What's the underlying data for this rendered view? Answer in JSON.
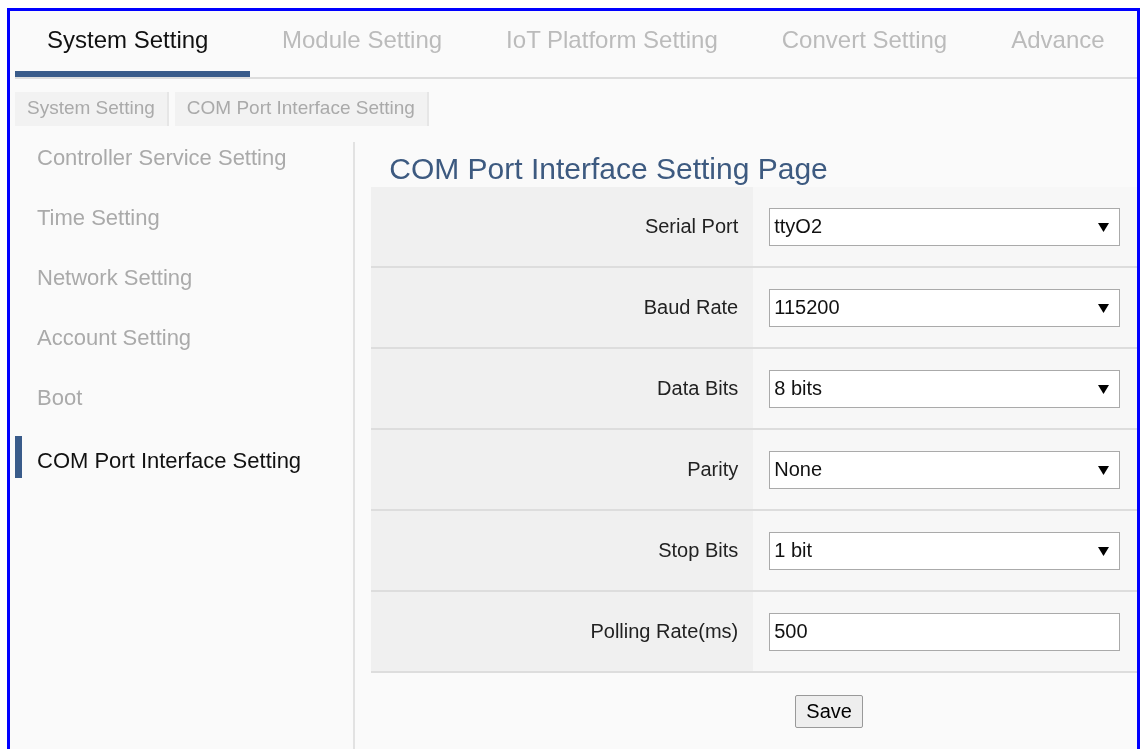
{
  "tabs": [
    {
      "label": "System Setting",
      "selected": true
    },
    {
      "label": "Module Setting",
      "selected": false
    },
    {
      "label": "IoT Platform Setting",
      "selected": false
    },
    {
      "label": "Convert Setting",
      "selected": false
    },
    {
      "label": "Advance",
      "selected": false
    }
  ],
  "breadcrumb": [
    "System Setting",
    "COM Port Interface Setting"
  ],
  "sidebar": {
    "items": [
      {
        "label": "Controller Service Setting",
        "selected": false
      },
      {
        "label": "Time Setting",
        "selected": false
      },
      {
        "label": "Network Setting",
        "selected": false
      },
      {
        "label": "Account Setting",
        "selected": false
      },
      {
        "label": "Boot",
        "selected": false
      },
      {
        "label": "COM Port Interface Setting",
        "selected": true
      }
    ]
  },
  "page_title": "COM Port Interface Setting Page",
  "fields": [
    {
      "kind": "select",
      "label": "Serial Port",
      "value": "ttyO2"
    },
    {
      "kind": "select",
      "label": "Baud Rate",
      "value": "115200"
    },
    {
      "kind": "select",
      "label": "Data Bits",
      "value": "8 bits"
    },
    {
      "kind": "select",
      "label": "Parity",
      "value": "None"
    },
    {
      "kind": "select",
      "label": "Stop Bits",
      "value": "1 bit"
    },
    {
      "kind": "text",
      "label": "Polling Rate(ms)",
      "value": "500"
    }
  ],
  "save_button": "Save"
}
